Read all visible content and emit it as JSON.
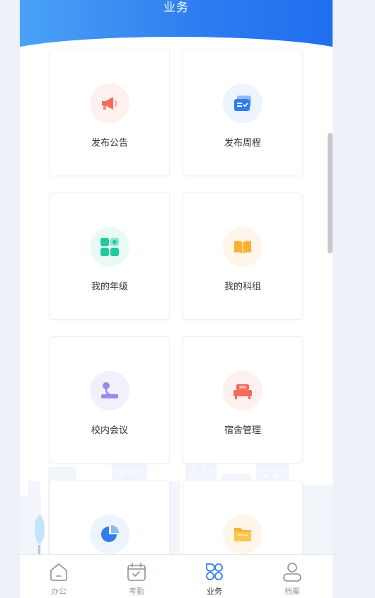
{
  "header": {
    "title": "业务"
  },
  "cards": [
    {
      "label": "发布公告",
      "icon": "megaphone-icon",
      "bg": "#fdf0ee",
      "color": "#f26b5b"
    },
    {
      "label": "发布周程",
      "icon": "schedule-card-icon",
      "bg": "#edf4fe",
      "color": "#2f7ef0"
    },
    {
      "label": "我的年级",
      "icon": "grade-grid-icon",
      "bg": "#e9faf5",
      "color": "#23c99a"
    },
    {
      "label": "我的科组",
      "icon": "book-icon",
      "bg": "#fff5e8",
      "color": "#f8b231"
    },
    {
      "label": "校内会议",
      "icon": "microphone-icon",
      "bg": "#f3f0fd",
      "color": "#9a8af0"
    },
    {
      "label": "宿舍管理",
      "icon": "bed-icon",
      "bg": "#fdf0ee",
      "color": "#f26b5b"
    },
    {
      "label": "",
      "icon": "pie-chart-icon",
      "bg": "#edf4fe",
      "color": "#2f7ef0"
    },
    {
      "label": "",
      "icon": "folder-icon",
      "bg": "#fff5e8",
      "color": "#f8b231"
    }
  ],
  "tabs": [
    {
      "label": "办公",
      "icon": "home-icon"
    },
    {
      "label": "考勤",
      "icon": "calendar-check-icon"
    },
    {
      "label": "业务",
      "icon": "business-clover-icon",
      "active": true
    },
    {
      "label": "档案",
      "icon": "profile-icon"
    }
  ],
  "colors": {
    "accent": "#2f7ef0",
    "tab_inactive": "#999999"
  }
}
